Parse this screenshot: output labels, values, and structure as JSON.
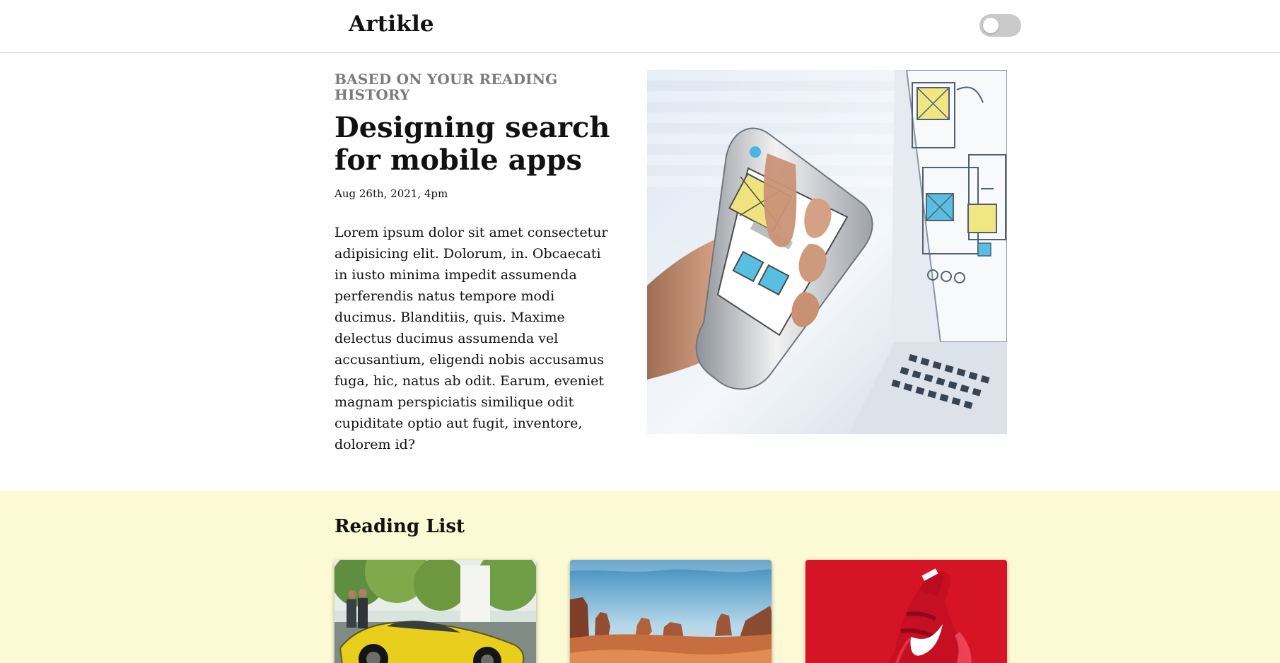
{
  "header": {
    "brand": "Artikle",
    "theme_toggle": "off"
  },
  "feature": {
    "eyebrow": "BASED ON YOUR READING HISTORY",
    "title": "Designing search for mobile apps",
    "date": "Aug 26th, 2021, 4pm",
    "body": "Lorem ipsum dolor sit amet consectetur adipisicing elit. Dolorum, in. Obcaecati in iusto minima impedit assumenda perferendis natus tempore modi ducimus. Blanditiis, quis. Maxime delectus ducimus assumenda vel accusantium, eligendi nobis accusamus fuga, hic, natus ab odit. Earum, eveniet magnam perspiciatis similique odit cupiditate optio aut fugit, inventore, dolorem id?"
  },
  "reading_list": {
    "title": "Reading List"
  },
  "colors": {
    "header_background": "#ffffff",
    "reading_background": "#fbfad4",
    "eyebrow": "#7b7b7b",
    "toggle_off": "#c9c9c9"
  }
}
